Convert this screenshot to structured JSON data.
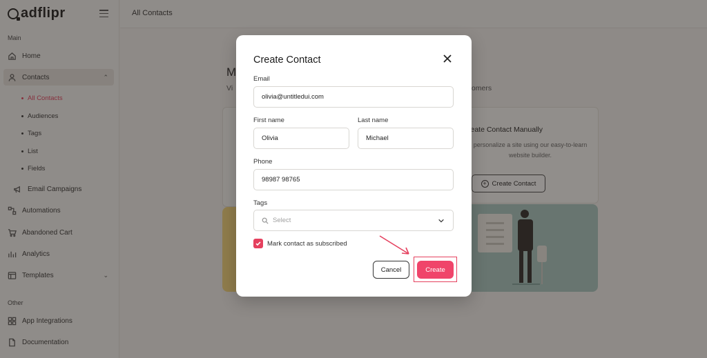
{
  "app": {
    "brand": "adflipr"
  },
  "topbar": {
    "title": "All Contacts"
  },
  "sidebar": {
    "main_label": "Main",
    "other_label": "Other",
    "items": [
      {
        "label": "Home",
        "icon": "home-icon"
      },
      {
        "label": "Contacts",
        "icon": "user-icon"
      },
      {
        "label": "Email Campaigns",
        "icon": "megaphone-icon"
      },
      {
        "label": "Automations",
        "icon": "automation-icon"
      },
      {
        "label": "Abandoned Cart",
        "icon": "cart-icon"
      },
      {
        "label": "Analytics",
        "icon": "chart-icon"
      },
      {
        "label": "Templates",
        "icon": "template-icon"
      }
    ],
    "contacts_sub": [
      {
        "label": "All Contacts"
      },
      {
        "label": "Audiences"
      },
      {
        "label": "Tags"
      },
      {
        "label": "List"
      },
      {
        "label": "Fields"
      }
    ],
    "other_items": [
      {
        "label": "App Integrations",
        "icon": "grid-icon"
      },
      {
        "label": "Documentation",
        "icon": "document-icon"
      }
    ]
  },
  "background": {
    "heading": "M",
    "subtext": "Vi",
    "subtext_right": "tomers",
    "card_title": "reate Contact Manually",
    "card_text": "personalize a site using our easy-to-learn website builder.",
    "card_button": "Create Contact"
  },
  "modal": {
    "title": "Create Contact",
    "email": {
      "label": "Email",
      "value": "olivia@untitledui.com"
    },
    "first_name": {
      "label": "First name",
      "value": "Olivia"
    },
    "last_name": {
      "label": "Last name",
      "value": "Michael"
    },
    "phone": {
      "label": "Phone",
      "value": "98987 98765"
    },
    "tags": {
      "label": "Tags",
      "placeholder": "Select"
    },
    "subscribed": {
      "label": "Mark contact as subscribed",
      "checked": true
    },
    "cancel_label": "Cancel",
    "create_label": "Create"
  },
  "colors": {
    "accent": "#f0446a",
    "overlay": "rgba(40,34,30,0.5)"
  }
}
